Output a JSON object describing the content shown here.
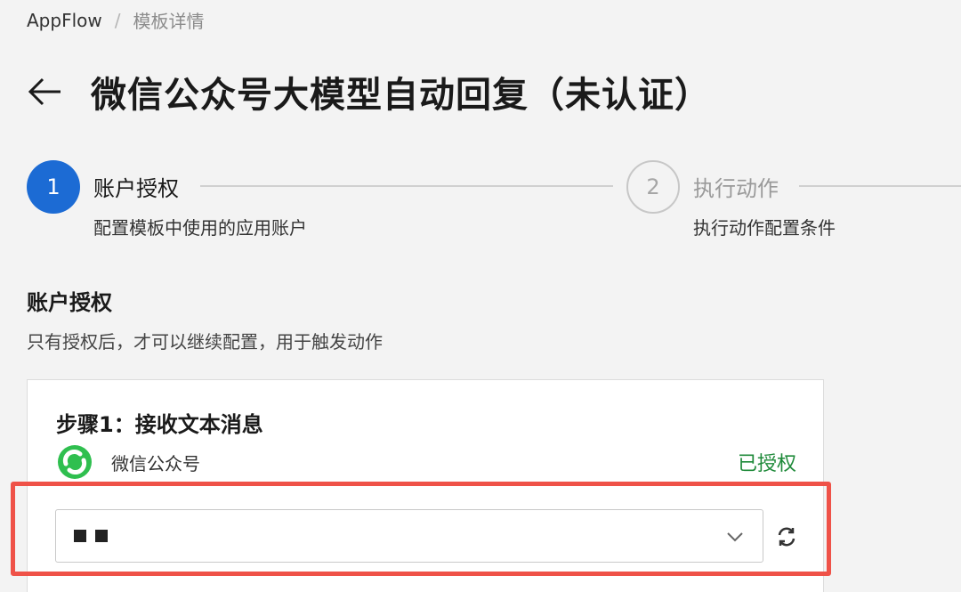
{
  "breadcrumb": {
    "root": "AppFlow",
    "separator": "/",
    "current": "模板详情"
  },
  "header": {
    "title": "微信公众号大模型自动回复（未认证）"
  },
  "steps": [
    {
      "number": "1",
      "title": "账户授权",
      "description": "配置模板中使用的应用账户",
      "active": true
    },
    {
      "number": "2",
      "title": "执行动作",
      "description": "执行动作配置条件",
      "active": false
    }
  ],
  "section": {
    "title": "账户授权",
    "description": "只有授权后，才可以继续配置，用于触发动作"
  },
  "card": {
    "step_title": "步骤1：接收文本消息",
    "app_name": "微信公众号",
    "app_icon": "wechat-official-account-logo",
    "status": "已授权",
    "status_color": "#1f8a3a"
  },
  "colors": {
    "primary": "#1c6bd4",
    "highlight": "#ef5248"
  }
}
